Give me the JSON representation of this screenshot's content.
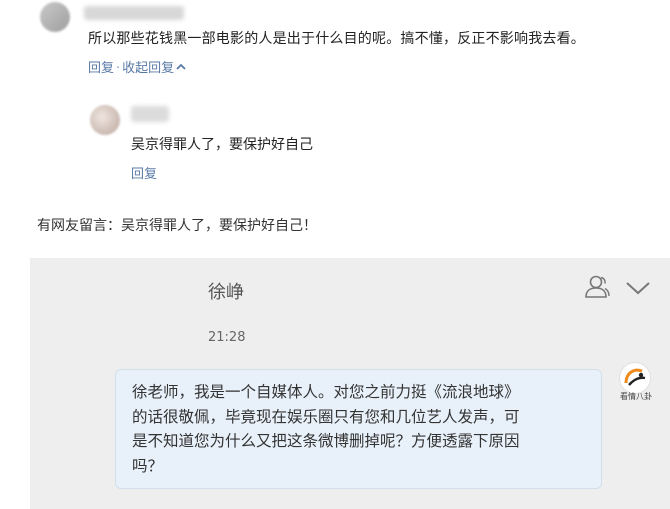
{
  "comment": {
    "text": "所以那些花钱黑一部电影的人是出于什么目的呢。搞不懂，反正不影响我去看。",
    "reply_label": "回复",
    "separator": "·",
    "collapse_label": "收起回复",
    "collapse_glyph": "^"
  },
  "sub_reply": {
    "text": "吴京得罪人了，要保护好自己",
    "reply_label": "回复"
  },
  "note": "有网友留言：吴京得罪人了，要保护好自己！",
  "chat": {
    "name": "徐峥",
    "time": "21:28",
    "message": "徐老师，我是一个自媒体人。对您之前力挺《流浪地球》\n的话很敬佩，毕竟现在娱乐圈只有您和几位艺人发声，可\n是不知道您为什么又把这条微博删掉呢？方便透露下原因\n吗？",
    "logo_text": "看情八卦",
    "icons": [
      "user-group-icon",
      "chevron-down-icon"
    ]
  },
  "colors": {
    "link": "#5a7aa6",
    "panel_bg": "#eeeeee",
    "bubble_bg": "#e8f1fa",
    "logo_orange": "#f08a1c"
  }
}
